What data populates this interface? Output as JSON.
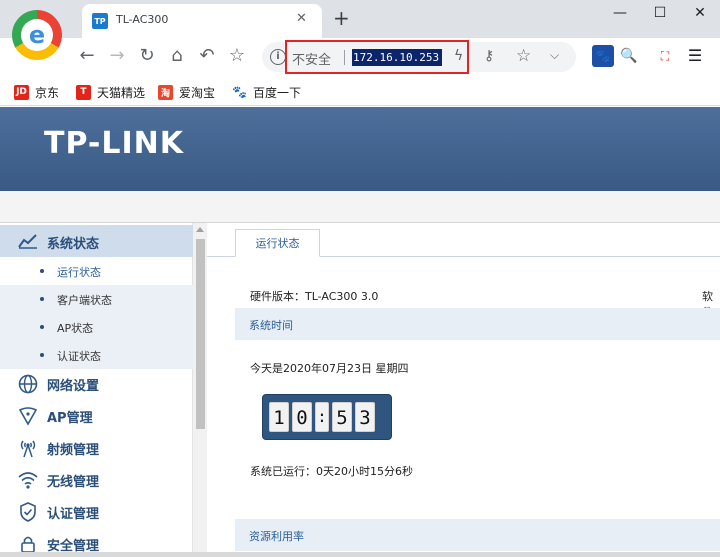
{
  "browser": {
    "tab_title": "TL-AC300",
    "tab_favicon": "TP",
    "insecure_label": "不安全",
    "url": "172.16.10.253",
    "window_controls": {
      "minimize": "—",
      "maximize": "☐",
      "close": "✕"
    },
    "icons": [
      "back-icon",
      "forward-icon",
      "reload-icon",
      "home-icon",
      "undo-icon",
      "star-icon",
      "info-icon",
      "lightning-icon",
      "key-icon",
      "chevron-down-icon",
      "paw-icon",
      "search-icon",
      "pdf-icon",
      "menu-icon"
    ]
  },
  "bookmarks": [
    {
      "icon": "JD",
      "label": "京东",
      "color": "#e1251b"
    },
    {
      "icon": "T",
      "label": "天猫精选",
      "color": "#e1251b"
    },
    {
      "icon": "淘",
      "label": "爱淘宝",
      "color": "#e8462d"
    },
    {
      "icon": "🐾",
      "label": "百度一下",
      "color": "#2f6be0"
    }
  ],
  "header": {
    "brand": "TP-LINK"
  },
  "sidebar": {
    "active_section": "系统状态",
    "sub_items": [
      {
        "label": "运行状态",
        "active": true
      },
      {
        "label": "客户端状态",
        "active": false
      },
      {
        "label": "AP状态",
        "active": false
      },
      {
        "label": "认证状态",
        "active": false
      }
    ],
    "sections": [
      {
        "label": "网络设置",
        "icon": "globe-icon"
      },
      {
        "label": "AP管理",
        "icon": "ap-icon"
      },
      {
        "label": "射频管理",
        "icon": "antenna-icon"
      },
      {
        "label": "无线管理",
        "icon": "wifi-icon"
      },
      {
        "label": "认证管理",
        "icon": "shield-check-icon"
      },
      {
        "label": "安全管理",
        "icon": "lock-icon"
      }
    ]
  },
  "main": {
    "tab_label": "运行状态",
    "hardware_version": "硬件版本：TL-AC300 3.0",
    "software_version_prefix": "软件",
    "system_time_title": "系统时间",
    "date_line": "今天是2020年07月23日 星期四",
    "clock": {
      "h1": "1",
      "h2": "0",
      "sep": ":",
      "m1": "5",
      "m2": "3"
    },
    "uptime": "系统已运行：0天20小时15分6秒",
    "resource_title": "资源利用率"
  },
  "colors": {
    "banner": "#4d6f9a",
    "accent": "#2b5e98",
    "highlight_box": "#e02525",
    "url_selection": "#0b246a"
  }
}
